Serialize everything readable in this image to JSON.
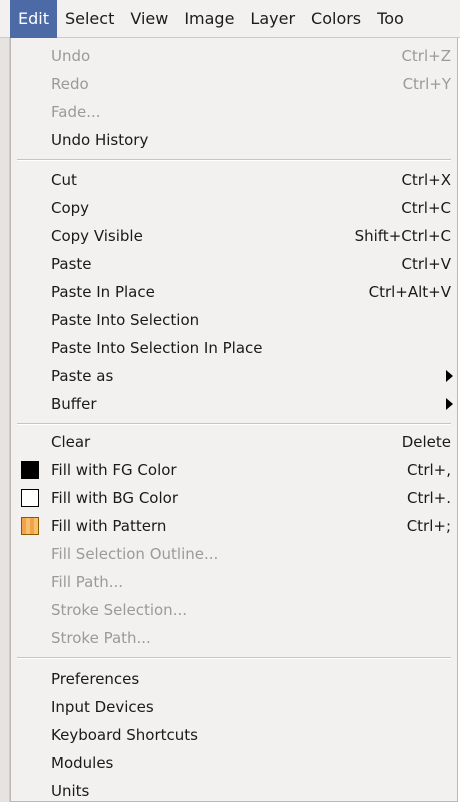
{
  "menubar": {
    "items": [
      "Edit",
      "Select",
      "View",
      "Image",
      "Layer",
      "Colors",
      "Too"
    ]
  },
  "edit_menu": {
    "group1": [
      {
        "label": "Undo",
        "accel": "Ctrl+Z",
        "disabled": true
      },
      {
        "label": "Redo",
        "accel": "Ctrl+Y",
        "disabled": true
      },
      {
        "label": "Fade...",
        "accel": "",
        "disabled": true
      },
      {
        "label": "Undo History",
        "accel": "",
        "disabled": false
      }
    ],
    "group2": [
      {
        "label": "Cut",
        "accel": "Ctrl+X",
        "disabled": false
      },
      {
        "label": "Copy",
        "accel": "Ctrl+C",
        "disabled": false
      },
      {
        "label": "Copy Visible",
        "accel": "Shift+Ctrl+C",
        "disabled": false
      },
      {
        "label": "Paste",
        "accel": "Ctrl+V",
        "disabled": false
      },
      {
        "label": "Paste In Place",
        "accel": "Ctrl+Alt+V",
        "disabled": false
      },
      {
        "label": "Paste Into Selection",
        "accel": "",
        "disabled": false
      },
      {
        "label": "Paste Into Selection In Place",
        "accel": "",
        "disabled": false
      },
      {
        "label": "Paste as",
        "accel": "",
        "disabled": false,
        "submenu": true
      },
      {
        "label": "Buffer",
        "accel": "",
        "disabled": false,
        "submenu": true
      }
    ],
    "group3": [
      {
        "label": "Clear",
        "accel": "Delete",
        "disabled": false
      },
      {
        "label": "Fill with FG Color",
        "accel": "Ctrl+,",
        "disabled": false,
        "icon": "fg-color-swatch-icon"
      },
      {
        "label": "Fill with BG Color",
        "accel": "Ctrl+.",
        "disabled": false,
        "icon": "bg-color-swatch-icon"
      },
      {
        "label": "Fill with Pattern",
        "accel": "Ctrl+;",
        "disabled": false,
        "icon": "pattern-swatch-icon"
      },
      {
        "label": "Fill Selection Outline...",
        "accel": "",
        "disabled": true
      },
      {
        "label": "Fill Path...",
        "accel": "",
        "disabled": true
      },
      {
        "label": "Stroke Selection...",
        "accel": "",
        "disabled": true
      },
      {
        "label": "Stroke Path...",
        "accel": "",
        "disabled": true
      }
    ],
    "group4": [
      {
        "label": "Preferences",
        "accel": "",
        "disabled": false
      },
      {
        "label": "Input Devices",
        "accel": "",
        "disabled": false
      },
      {
        "label": "Keyboard Shortcuts",
        "accel": "",
        "disabled": false
      },
      {
        "label": "Modules",
        "accel": "",
        "disabled": false
      },
      {
        "label": "Units",
        "accel": "",
        "disabled": false
      }
    ]
  },
  "colors": {
    "menubar_active_bg": "#4b6aa6",
    "menu_bg": "#f2f1f0",
    "disabled_text": "#9a9a9a"
  }
}
